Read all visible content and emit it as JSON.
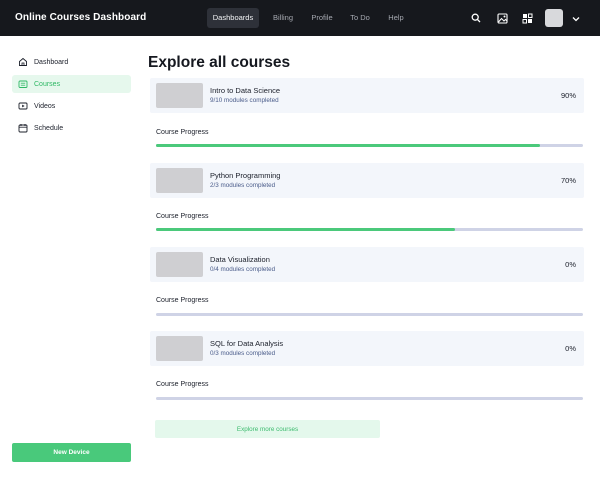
{
  "header": {
    "title": "Online Courses Dashboard",
    "nav": [
      {
        "label": "Dashboards",
        "active": true
      },
      {
        "label": "Billing",
        "active": false
      },
      {
        "label": "Profile",
        "active": false
      },
      {
        "label": "To Do",
        "active": false
      },
      {
        "label": "Help",
        "active": false
      }
    ],
    "icons": [
      "search-icon",
      "image-icon",
      "apps-icon",
      "avatar",
      "chevron-down-icon"
    ]
  },
  "sidebar": {
    "items": [
      {
        "label": "Dashboard",
        "icon": "home-icon",
        "active": false
      },
      {
        "label": "Courses",
        "icon": "courses-icon",
        "active": true
      },
      {
        "label": "Videos",
        "icon": "video-icon",
        "active": false
      },
      {
        "label": "Schedule",
        "icon": "calendar-icon",
        "active": false
      }
    ],
    "new_device_label": "New Device"
  },
  "main": {
    "title": "Explore all courses",
    "courses": [
      {
        "name": "Intro to Data Science",
        "modules": "9/10 modules completed",
        "percent_label": "90%",
        "progress": 0.9,
        "progress_label": "Course Progress"
      },
      {
        "name": "Python Programming",
        "modules": "2/3 modules completed",
        "percent_label": "70%",
        "progress": 0.7,
        "progress_label": "Course Progress"
      },
      {
        "name": "Data Visualization",
        "modules": "0/4 modules completed",
        "percent_label": "0%",
        "progress": 0,
        "progress_label": "Course Progress"
      },
      {
        "name": "SQL for Data Analysis",
        "modules": "0/3 modules completed",
        "percent_label": "0%",
        "progress": 0,
        "progress_label": "Course Progress"
      }
    ],
    "explore_label": "Explore more courses"
  },
  "colors": {
    "topbar": "#16181d",
    "accent_green": "#49c97b",
    "progress_track": "#cfd3e6",
    "card_bg": "#f3f6fb"
  }
}
